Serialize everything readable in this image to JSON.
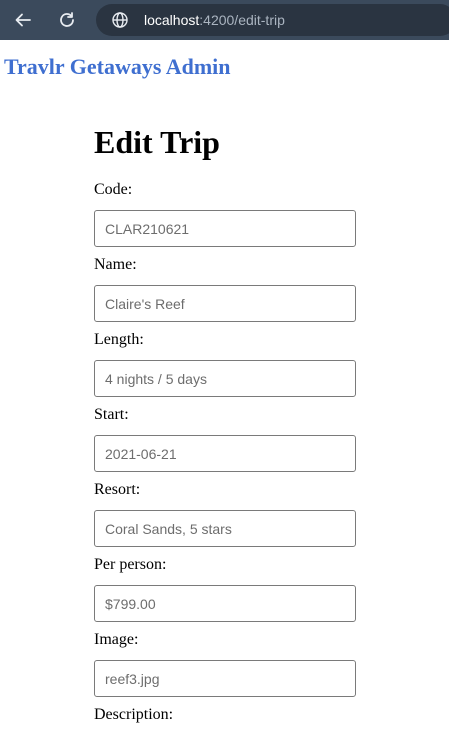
{
  "browser": {
    "url_host": "localhost",
    "url_path": ":4200/edit-trip"
  },
  "brand": "Travlr Getaways Admin",
  "page_title": "Edit Trip",
  "fields": [
    {
      "label": "Code:",
      "value": "CLAR210621"
    },
    {
      "label": "Name:",
      "value": "Claire's Reef"
    },
    {
      "label": "Length:",
      "value": "4 nights / 5 days"
    },
    {
      "label": "Start:",
      "value": "2021-06-21"
    },
    {
      "label": "Resort:",
      "value": "Coral Sands, 5 stars"
    },
    {
      "label": "Per person:",
      "value": "$799.00"
    },
    {
      "label": "Image:",
      "value": "reef3.jpg"
    },
    {
      "label": "Description:",
      "value": ""
    }
  ]
}
